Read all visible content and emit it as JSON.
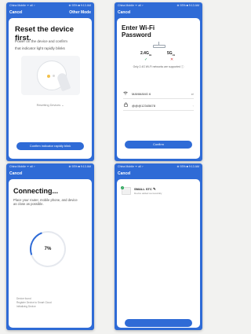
{
  "colors": {
    "accent": "#2f6bd6",
    "success": "#27a35a",
    "error": "#d64545"
  },
  "screen1": {
    "status_left": "China Mobile ᯤ all ⌐",
    "status_right": "⊕ 93% ■ 9:13 AM",
    "nav_left": "Cancel",
    "nav_right": "Other Mode",
    "title": "Reset the device first.",
    "line1": "Power on the device and confirm",
    "line2": "that indicator light rapidly blinks",
    "reset_link": "Resetting Devices ⌄",
    "button": "Confirm indicator rapidly blink"
  },
  "screen2": {
    "status_left": "China Mobile ᯤ all ⌐",
    "status_right": "⊕ 93% ■ 9:13 AM",
    "nav_left": "Cancel",
    "title_line1": "Enter Wi-Fi",
    "title_line2": "Password",
    "band_24": "2.4G",
    "band_24_unit": "Hz",
    "band_5": "5G",
    "band_5_unit": "Hz",
    "note": "Only 2.4G Wi-Fi networks are supported ⓘ",
    "wifi_name": "MANMANG 6",
    "password": "@@@12345678",
    "button": "Confirm",
    "icons": [
      "wifi-icon",
      "lock-icon",
      "check-icon",
      "cross-icon"
    ]
  },
  "screen3": {
    "status_left": "China Mobile ᯤ all ⌐",
    "status_right": "⊕ 93% ■ 9:13 AM",
    "nav_left": "Cancel",
    "title": "Connecting...",
    "text": "Place your router, mobile phone, and device as close as possible.",
    "progress_value": 7,
    "progress_label": "7%",
    "steps": [
      "Device found",
      "Register Device to Smart Cloud",
      "Initializing Device"
    ]
  },
  "screen4": {
    "status_left": "China Mobile ᯤ all ⌐",
    "status_right": "⊕ 93% ■ 9:13 AM",
    "nav_left": "Cancel",
    "device_name": "SMALL STC",
    "device_status": "Device added successfully",
    "button": ""
  }
}
